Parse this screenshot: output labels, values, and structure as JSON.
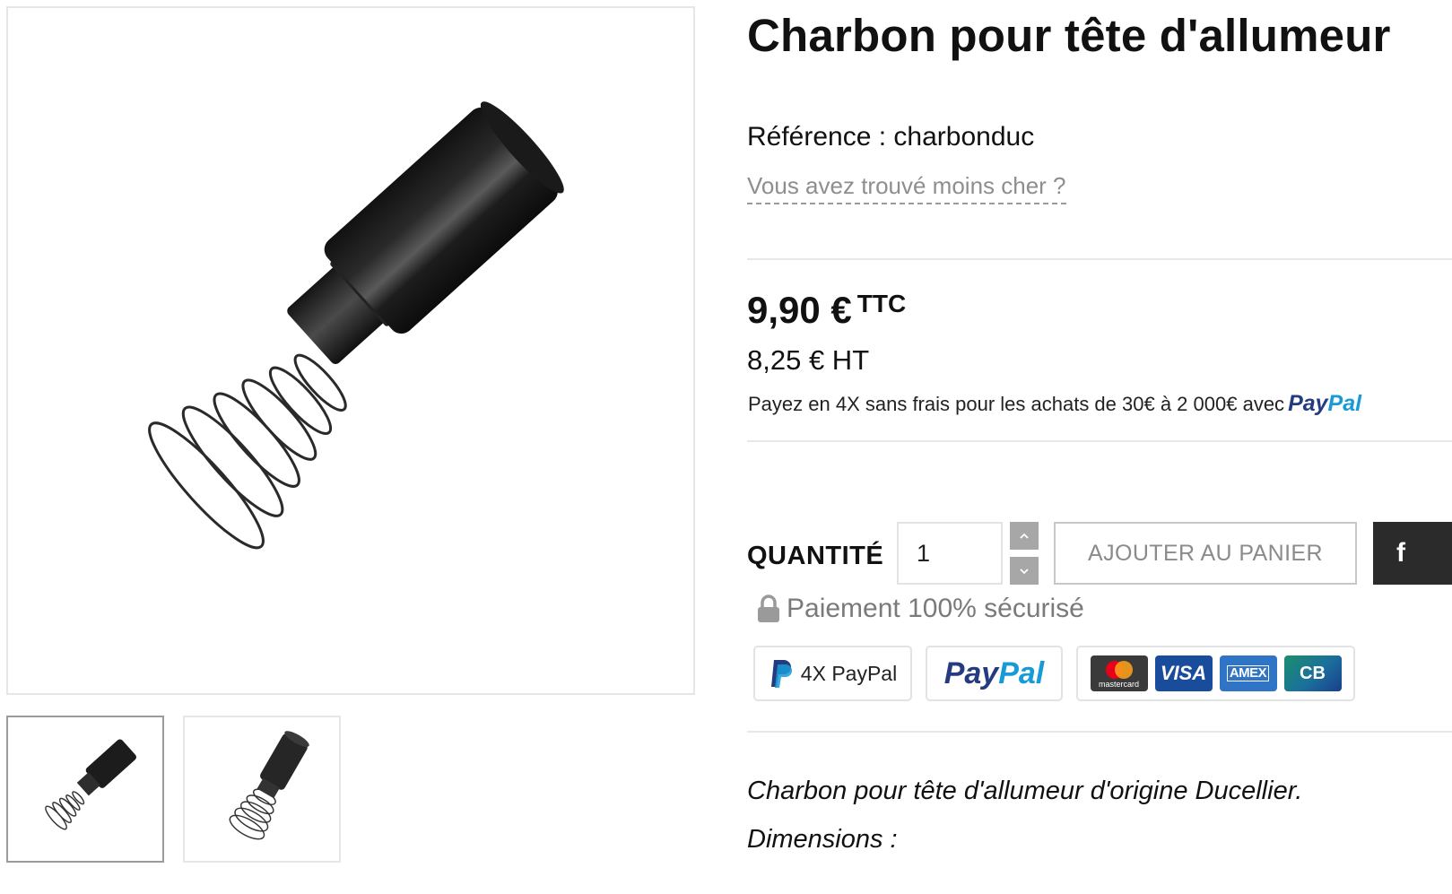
{
  "product": {
    "title": "Charbon pour tête d'allumeur",
    "reference_label": "Référence : charbonduc",
    "cheaper_link": "Vous avez trouvé moins cher ?"
  },
  "price": {
    "ttc_amount": "9,90 €",
    "ttc_suffix": "TTC",
    "ht": "8,25 € HT",
    "paypal_note": "Payez en 4X sans frais pour les achats de 30€ à 2 000€ avec",
    "paypal_logo_dark": "Pay",
    "paypal_logo_light": "Pal"
  },
  "purchase": {
    "quantity_label": "QUANTITÉ",
    "quantity_value": "1",
    "add_to_cart_label": "AJOUTER AU PANIER",
    "dark_button_label": "f"
  },
  "payment": {
    "secure_label": "Paiement 100% sécurisé",
    "badge_4x_label": "4X PayPal",
    "paypal_badge_dark": "Pay",
    "paypal_badge_light": "Pal",
    "cards": {
      "mastercard": "mastercard",
      "visa": "VISA",
      "amex": "AMEX",
      "cb": "CB"
    }
  },
  "description": {
    "line1": "Charbon pour tête d'allumeur d'origine Ducellier.",
    "line2": "Dimensions :"
  },
  "gallery": {
    "thumbnails": [
      "thumb-1",
      "thumb-2"
    ],
    "selected_index": 0
  },
  "colors": {
    "paypal_dark": "#253b80",
    "paypal_light": "#179bd7",
    "qty_button": "#a7a7a7",
    "dark_button": "#2b2b2b"
  },
  "icons": {
    "lock": "lock-icon",
    "chevron_up": "chevron-up-icon",
    "chevron_down": "chevron-down-icon",
    "paypal_p": "paypal-p-icon"
  }
}
